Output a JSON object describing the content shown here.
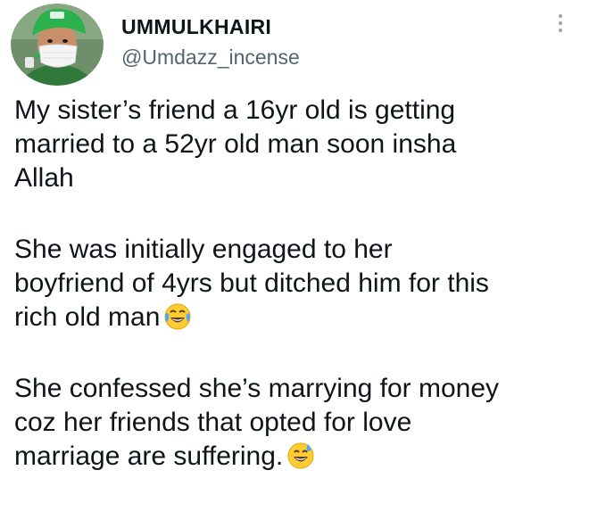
{
  "user": {
    "display_name": "UMMULKHAIRI",
    "handle": "@Umdazz_incense"
  },
  "header": {
    "more_icon": "more-vertical-icon"
  },
  "tweet": {
    "paragraphs": [
      {
        "lines": [
          "My sister’s friend a 16yr old is getting",
          "married to a 52yr old man soon insha",
          "Allah"
        ],
        "emoji": ""
      },
      {
        "lines": [
          "She was initially engaged to her",
          "boyfriend of 4yrs but ditched him for this",
          "rich old man"
        ],
        "emoji": "face-with-tears-of-joy-icon"
      },
      {
        "lines": [
          "She confessed she’s marrying for money",
          "coz her friends that opted for love",
          "marriage are suffering."
        ],
        "emoji": "grinning-face-with-sweat-icon"
      }
    ]
  },
  "colors": {
    "text": "#0f1419",
    "secondary_text": "#536471",
    "avatar_cap": "#2bb24c",
    "background": "#ffffff"
  }
}
